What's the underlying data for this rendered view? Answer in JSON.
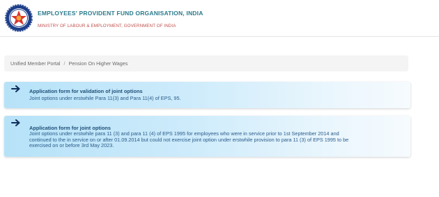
{
  "header": {
    "title": "EMPLOYEES' PROVIDENT FUND ORGANISATION, INDIA",
    "subtitle": "MINISTRY OF LABOUR & EMPLOYMENT, GOVERNMENT OF INDIA",
    "logo_icon": "epfo-emblem-icon"
  },
  "breadcrumb": {
    "items": [
      "Unified Member Portal",
      "Pension On Higher Wages"
    ],
    "separator": "/"
  },
  "cards": [
    {
      "title": "Application form for validation of joint options",
      "description": "Joint options under erstwhile Para 11(3) and Para 11(4) of EPS, 95.",
      "icon": "arrow-right-icon"
    },
    {
      "title": "Application form for joint options",
      "description": "Joint options under erstwhile para 11 (3) and para 11 (4) of EPS 1995 for employees who were in service prior to 1st September 2014 and continued to the in service on or after 01.09.2014 but could not exercise joint option under erstwhile provision to para 11 (3) of EPS 1995 to be exercised on or before 3rd May 2023.",
      "icon": "arrow-right-icon"
    }
  ],
  "colors": {
    "brand_teal": "#2a7a8c",
    "ministry_red": "#c0504d",
    "card_title": "#1f4f78",
    "card_text": "#2a5b8a",
    "card_bg_start": "#b6e2f8"
  }
}
